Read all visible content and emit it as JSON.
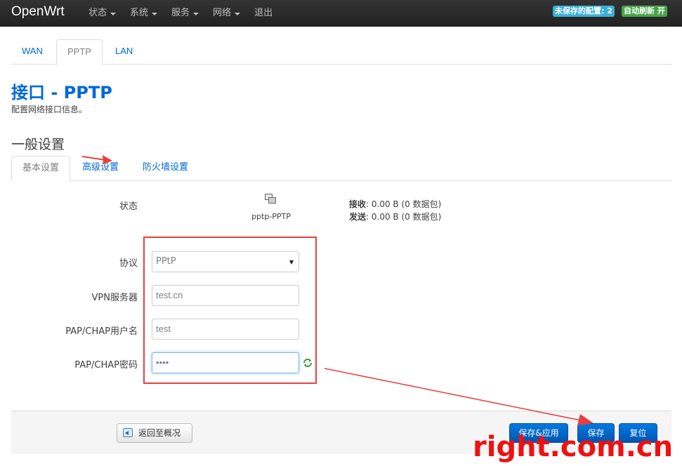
{
  "navbar": {
    "brand": "OpenWrt",
    "menu": [
      {
        "label": "状态",
        "has_caret": true
      },
      {
        "label": "系统",
        "has_caret": true
      },
      {
        "label": "服务",
        "has_caret": true
      },
      {
        "label": "网络",
        "has_caret": true
      },
      {
        "label": "退出",
        "has_caret": false
      }
    ],
    "unsaved_badge": "未保存的配置: 2",
    "refresh_badge": "自动刷新 开"
  },
  "top_tabs": [
    {
      "label": "WAN",
      "active": false
    },
    {
      "label": "PPTP",
      "active": true
    },
    {
      "label": "LAN",
      "active": false
    }
  ],
  "page": {
    "title": "接口 - PPTP",
    "description": "配置网络接口信息。"
  },
  "section": {
    "title": "一般设置",
    "tabs": [
      {
        "label": "基本设置",
        "active": true
      },
      {
        "label": "高级设置",
        "active": false
      },
      {
        "label": "防火墙设置",
        "active": false
      }
    ]
  },
  "status": {
    "label": "状态",
    "interface_name": "pptp-PPTP",
    "rx_label": "接收",
    "rx_value": ": 0.00 B (0 数据包)",
    "tx_label": "发送",
    "tx_value": ": 0.00 B (0 数据包)"
  },
  "form": {
    "protocol_label": "协议",
    "protocol_value": "PPtP",
    "server_label": "VPN服务器",
    "server_value": "test.cn",
    "username_label": "PAP/CHAP用户名",
    "username_value": "test",
    "password_label": "PAP/CHAP密码",
    "password_value": "••••"
  },
  "actions": {
    "back": "返回至概况",
    "save_apply": "保存&应用",
    "save": "保存",
    "reset": "复位"
  },
  "watermark": "right.com.cn",
  "colors": {
    "link": "#0069d6",
    "annotation_red": "#e84040",
    "primary_button": "#0062c4"
  }
}
